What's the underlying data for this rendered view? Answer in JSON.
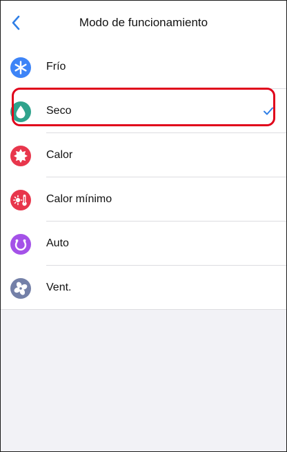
{
  "header": {
    "title": "Modo de funcionamiento",
    "back_icon": "chevron-left-icon"
  },
  "modes": [
    {
      "label": "Frío",
      "icon": "snowflake-icon",
      "color": "#3D84F7",
      "selected": false
    },
    {
      "label": "Seco",
      "icon": "water-drop-icon",
      "color": "#2FA38C",
      "selected": true
    },
    {
      "label": "Calor",
      "icon": "sun-icon",
      "color": "#E8364C",
      "selected": false
    },
    {
      "label": "Calor mínimo",
      "icon": "thermometer-sun-icon",
      "color": "#E8364C",
      "selected": false
    },
    {
      "label": "Auto",
      "icon": "auto-cycle-icon",
      "color": "#A452E8",
      "selected": false
    },
    {
      "label": "Vent.",
      "icon": "fan-icon",
      "color": "#7480A8",
      "selected": false
    }
  ],
  "check_color": "#2F7FE6",
  "highlight_color": "#E0001A"
}
